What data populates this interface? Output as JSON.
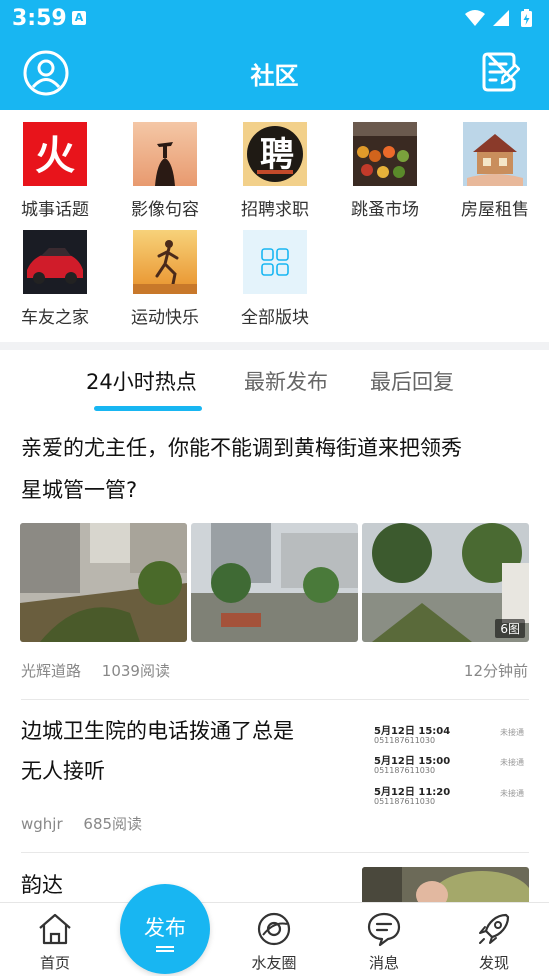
{
  "status_bar": {
    "time": "3:59",
    "notif_badge": "A"
  },
  "header": {
    "title": "社区",
    "profile_icon": "user-circle-icon",
    "compose_icon": "edit-note-icon"
  },
  "categories": [
    {
      "label": "城事话题",
      "icon": "fire-icon"
    },
    {
      "label": "影像句容",
      "icon": "sunset-photo-icon"
    },
    {
      "label": "招聘求职",
      "icon": "recruit-icon",
      "glyph": "聘"
    },
    {
      "label": "跳蚤市场",
      "icon": "market-photo-icon"
    },
    {
      "label": "房屋租售",
      "icon": "house-icon"
    },
    {
      "label": "车友之家",
      "icon": "car-icon"
    },
    {
      "label": "运动快乐",
      "icon": "runner-icon"
    },
    {
      "label": "全部版块",
      "icon": "grid-icon"
    }
  ],
  "tabs": [
    {
      "label": "24小时热点"
    },
    {
      "label": "最新发布"
    },
    {
      "label": "最后回复"
    }
  ],
  "posts": [
    {
      "title_line1": "亲爱的尤主任，你能不能调到黄梅街道来把领秀",
      "title_line2": "星城管一管?",
      "author": "光辉道路",
      "reads": "1039阅读",
      "time": "12分钟前",
      "photo_count": "6图"
    },
    {
      "title_line1": "边城卫生院的电话拨通了总是",
      "title_line2": "无人接听",
      "author": "wghjr",
      "reads": "685阅读",
      "calls": [
        {
          "date": "5月12日 15:04",
          "number": "051187611030",
          "status": "未接通"
        },
        {
          "date": "5月12日 15:00",
          "number": "051187611030",
          "status": "未接通"
        },
        {
          "date": "5月12日 11:20",
          "number": "051187611030",
          "status": "未接通"
        }
      ]
    },
    {
      "title_line1": "韵达"
    }
  ],
  "bottom_nav": [
    {
      "label": "首页",
      "icon": "home-icon"
    },
    {
      "label": "水友圈",
      "icon": "planet-icon"
    },
    {
      "label": "消息",
      "icon": "chat-bubble-icon"
    },
    {
      "label": "发现",
      "icon": "rocket-icon"
    }
  ],
  "fab": {
    "label": "发布"
  },
  "colors": {
    "accent": "#18b6f2",
    "fire_bg": "#e8141b"
  }
}
